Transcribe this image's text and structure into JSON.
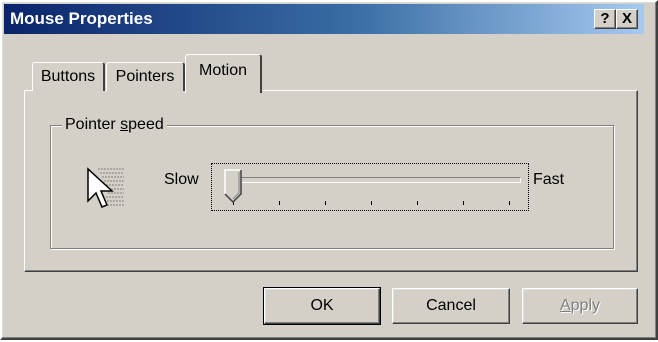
{
  "window": {
    "title": "Mouse Properties",
    "help_glyph": "?",
    "close_glyph": "X"
  },
  "tabs": [
    {
      "label": "Buttons",
      "selected": false
    },
    {
      "label": "Pointers",
      "selected": false
    },
    {
      "label": "Motion",
      "selected": true
    }
  ],
  "pointer_speed": {
    "group_label_pre": "Pointer ",
    "group_label_accel": "s",
    "group_label_post": "peed",
    "slow_label": "Slow",
    "fast_label": "Fast",
    "icon": "mouse-pointer-speed-icon",
    "tick_count": 7,
    "value_fraction": 0
  },
  "buttons": {
    "ok": "OK",
    "cancel": "Cancel",
    "apply_accel": "A",
    "apply_rest": "pply",
    "apply_enabled": false
  }
}
